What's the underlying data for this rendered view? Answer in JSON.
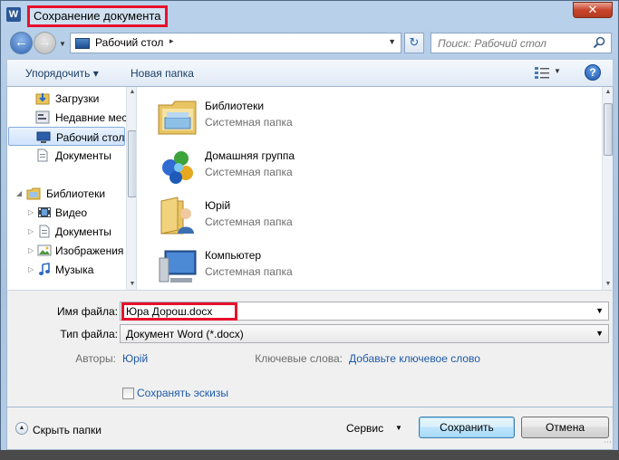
{
  "window": {
    "app_icon": "W",
    "title": "Сохранение документа",
    "close_glyph": "✕"
  },
  "nav": {
    "address": "Рабочий стол",
    "address_arrow": "▸",
    "search_placeholder": "Поиск: Рабочий стол"
  },
  "toolbar": {
    "organize": "Упорядочить ▾",
    "new_folder": "Новая папка",
    "help": "?"
  },
  "sidebar": {
    "items": [
      {
        "label": "Загрузки",
        "icon": "downloads-icon"
      },
      {
        "label": "Недавние места",
        "icon": "recent-places-icon"
      },
      {
        "label": "Рабочий стол",
        "icon": "desktop-icon",
        "selected": true
      },
      {
        "label": "Документы",
        "icon": "documents-icon"
      },
      {
        "label": "Библиотеки",
        "icon": "libraries-icon"
      },
      {
        "label": "Видео",
        "icon": "video-icon"
      },
      {
        "label": "Документы",
        "icon": "documents-icon"
      },
      {
        "label": "Изображения",
        "icon": "images-icon"
      },
      {
        "label": "Музыка",
        "icon": "music-icon"
      }
    ]
  },
  "files": [
    {
      "name": "Библиотеки",
      "type": "Системная папка",
      "icon": "libraries-folder-icon"
    },
    {
      "name": "Домашняя группа",
      "type": "Системная папка",
      "icon": "homegroup-icon"
    },
    {
      "name": "Юрій",
      "type": "Системная папка",
      "icon": "user-folder-icon"
    },
    {
      "name": "Компьютер",
      "type": "Системная папка",
      "icon": "computer-icon"
    }
  ],
  "form": {
    "filename_label": "Имя файла:",
    "filename_value": "Юра Дорош.docx",
    "filetype_label": "Тип файла:",
    "filetype_value": "Документ Word (*.docx)",
    "authors_label": "Авторы:",
    "authors_value": "Юрій",
    "keywords_label": "Ключевые слова:",
    "keywords_value": "Добавьте ключевое слово",
    "thumbnails_label": "Сохранять эскизы"
  },
  "footer": {
    "hide_folders": "Скрыть папки",
    "service": "Сервис",
    "save": "Сохранить",
    "cancel": "Отмена"
  },
  "colors": {
    "annotation_red": "#e8112d",
    "link_blue": "#1e5aa8"
  }
}
